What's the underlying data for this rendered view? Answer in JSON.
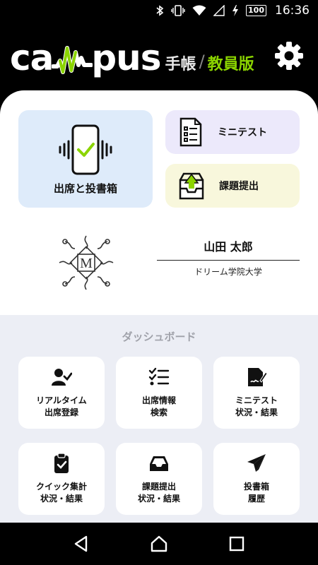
{
  "status_bar": {
    "battery": "100",
    "time": "16:36",
    "icons": [
      "bluetooth-icon",
      "vibrate-icon",
      "wifi-icon",
      "signal-icon",
      "charging-icon"
    ]
  },
  "header": {
    "logo_text_left": "ca",
    "logo_text_right": "pus",
    "logo_subtitle": "手帳",
    "logo_edition": "教員版",
    "accent_color": "#8bd400",
    "settings_icon": "gear-icon"
  },
  "tiles": {
    "attendance": {
      "label": "出席と投書箱",
      "icon": "phone-check-icon"
    },
    "minitest": {
      "label": "ミニテスト",
      "icon": "document-list-icon"
    },
    "assignment": {
      "label": "課題提出",
      "icon": "inbox-upload-icon"
    }
  },
  "profile": {
    "name": "山田 太郎",
    "school": "ドリーム学院大学",
    "emblem_letter": "M"
  },
  "dashboard": {
    "title": "ダッシュボード",
    "items": [
      {
        "line1": "リアルタイム",
        "line2": "出席登録",
        "icon": "user-check-icon"
      },
      {
        "line1": "出席情報",
        "line2": "検索",
        "icon": "checklist-icon"
      },
      {
        "line1": "ミニテスト",
        "line2": "状況・結果",
        "icon": "file-signature-icon"
      },
      {
        "line1": "クイック集計",
        "line2": "状況・結果",
        "icon": "clipboard-check-icon"
      },
      {
        "line1": "課題提出",
        "line2": "状況・結果",
        "icon": "inbox-icon"
      },
      {
        "line1": "投書箱",
        "line2": "履歴",
        "icon": "paper-plane-icon"
      }
    ]
  },
  "navbar": {
    "icons": [
      "back-icon",
      "home-icon",
      "recents-icon"
    ]
  }
}
